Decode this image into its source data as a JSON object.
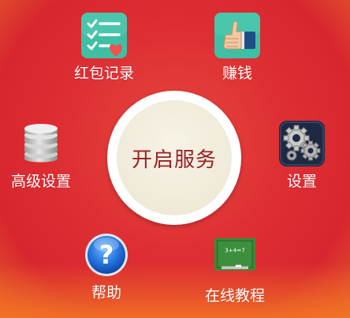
{
  "center": {
    "label": "开启服务"
  },
  "menu": {
    "red_packet_record": "红包记录",
    "earn_money": "赚钱",
    "advanced_settings": "高级设置",
    "settings": "设置",
    "help": "帮助",
    "tutorial": "在线教程"
  },
  "tutorial_board_text": "3+4=7",
  "colors": {
    "background": "#de2f33",
    "center_text": "#9b1f24",
    "label_text": "#ffffff",
    "teal_icon": "#3fbfa4"
  }
}
